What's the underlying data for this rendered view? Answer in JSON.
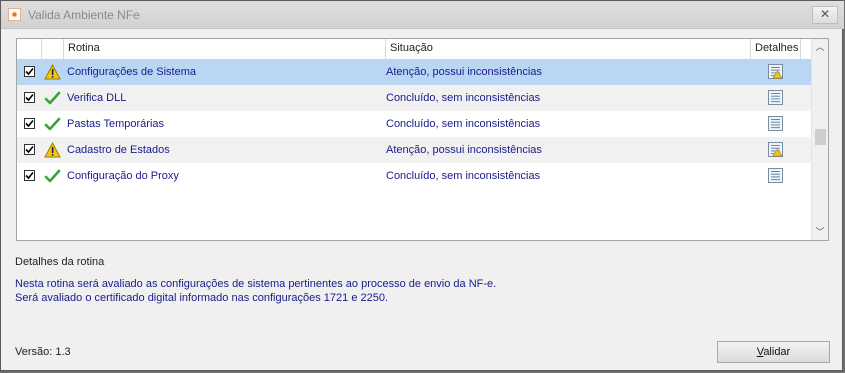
{
  "window": {
    "title": "Valida Ambiente NFe"
  },
  "grid": {
    "headers": {
      "rotina": "Rotina",
      "situacao": "Situação",
      "detalhes": "Detalhes"
    },
    "rows": [
      {
        "checked": true,
        "status": "warning-icon",
        "rotina": "Configurações de Sistema",
        "situacao": "Atenção, possui inconsistências",
        "selected": true
      },
      {
        "checked": true,
        "status": "checkmark-icon",
        "rotina": "Verifica DLL",
        "situacao": "Concluído, sem inconsistências"
      },
      {
        "checked": true,
        "status": "checkmark-icon",
        "rotina": "Pastas Temporárias",
        "situacao": "Concluído, sem inconsistências"
      },
      {
        "checked": true,
        "status": "warning-icon",
        "rotina": "Cadastro de Estados",
        "situacao": "Atenção, possui inconsistências"
      },
      {
        "checked": true,
        "status": "checkmark-icon",
        "rotina": "Configuração do Proxy",
        "situacao": "Concluído, sem inconsistências"
      }
    ]
  },
  "details": {
    "label": "Detalhes da rotina",
    "line1": "Nesta rotina será avaliado as configurações de sistema pertinentes ao processo de envio da NF-e.",
    "line2": "Será avaliado o certificado digital informado nas configurações 1721 e 2250."
  },
  "footer": {
    "version": "Versão: 1.3",
    "button_first": "V",
    "button_rest": "alidar"
  },
  "colors": {
    "selected_row": "#b9d7f3",
    "link_text": "#1a1a8c"
  }
}
